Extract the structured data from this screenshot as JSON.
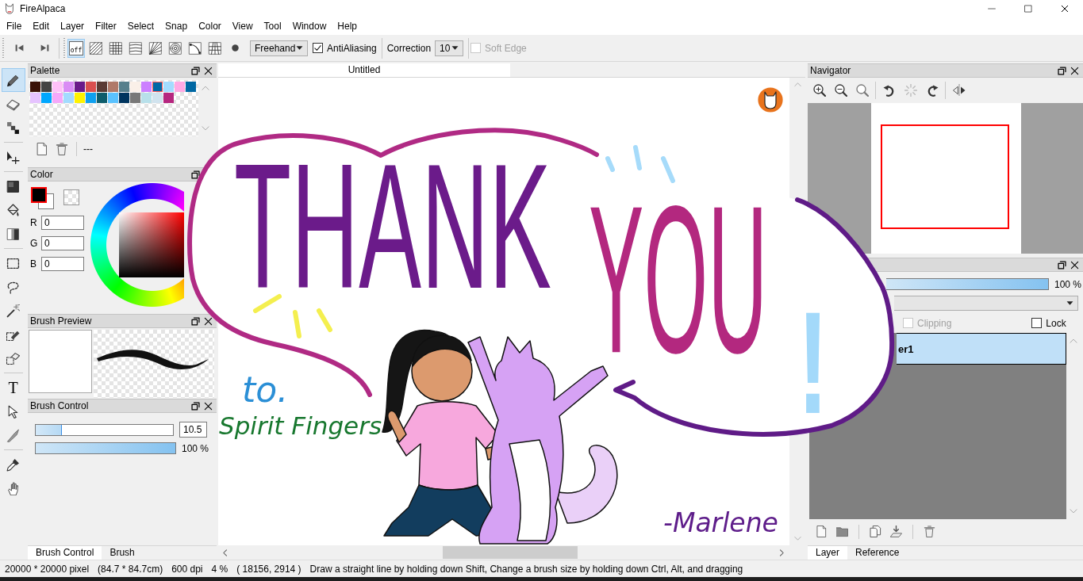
{
  "window": {
    "title": "FireAlpaca"
  },
  "menu": [
    "File",
    "Edit",
    "Layer",
    "Filter",
    "Select",
    "Snap",
    "Color",
    "View",
    "Tool",
    "Window",
    "Help"
  ],
  "toolbar": {
    "snap_modes": [
      {
        "label": "off",
        "selected": true
      },
      {
        "selected": false
      },
      {
        "selected": false
      },
      {
        "selected": false
      },
      {
        "selected": false
      },
      {
        "selected": false
      },
      {
        "selected": false
      },
      {
        "selected": false
      },
      {
        "selected": false
      }
    ],
    "stroke_mode": "Freehand",
    "antialiasing": {
      "label": "AntiAliasing",
      "checked": true
    },
    "correction": {
      "label": "Correction",
      "value": "10"
    },
    "soft_edge": {
      "label": "Soft Edge",
      "checked": false,
      "disabled": true
    }
  },
  "tool_groups": [
    [
      {
        "selected": true
      },
      {
        "selected": false
      },
      {
        "selected": false
      }
    ],
    [
      {
        "selected": false
      }
    ],
    [
      {
        "selected": false
      },
      {
        "selected": false
      },
      {
        "selected": false
      }
    ],
    [
      {
        "selected": false
      },
      {
        "selected": false
      },
      {
        "selected": false
      },
      {
        "selected": false
      },
      {
        "selected": false
      }
    ],
    [
      {
        "glyph": "T",
        "selected": false
      },
      {
        "selected": false
      },
      {
        "selected": false
      }
    ],
    [
      {
        "selected": false
      },
      {
        "selected": false
      }
    ]
  ],
  "palette": {
    "title": "Palette",
    "swatches": [
      {
        "color": "#3b1308",
        "selected": false
      },
      {
        "color": "#444444",
        "selected": false
      },
      {
        "color": "#ffc0f8",
        "selected": false
      },
      {
        "color": "#da8cf5",
        "selected": false
      },
      {
        "color": "#6b1a8a",
        "selected": false
      },
      {
        "color": "#da4f4f",
        "selected": false
      },
      {
        "color": "#5a3a34",
        "selected": false
      },
      {
        "color": "#b07a6a",
        "selected": false
      },
      {
        "color": "#567f8c",
        "selected": false
      },
      {
        "color": "#faf0e8",
        "selected": false
      },
      {
        "color": "#cc80ff",
        "selected": false
      },
      {
        "color": "#0068a6",
        "selected": true
      },
      {
        "color": "#a3dcff",
        "selected": false
      },
      {
        "color": "#ffaae4",
        "selected": false
      },
      {
        "color": "#0068a3",
        "selected": false
      },
      {
        "color": "#e6c3ff",
        "selected": false
      },
      {
        "color": "#00a7ff",
        "selected": false
      },
      {
        "color": "#f5a8fa",
        "selected": false
      },
      {
        "color": "#a3dbff",
        "selected": false
      },
      {
        "color": "#fff200",
        "selected": false
      },
      {
        "color": "#0fa0f0",
        "selected": false
      },
      {
        "color": "#0e5d6c",
        "selected": false
      },
      {
        "color": "#5ac2ff",
        "selected": false
      },
      {
        "color": "#00355f",
        "selected": false
      },
      {
        "color": "#787878",
        "selected": false
      },
      {
        "color": "#b8e0ea",
        "selected": false
      },
      {
        "color": "#d1e3ee",
        "selected": false
      },
      {
        "color": "#b6267f",
        "selected": false
      }
    ],
    "set_name": "---"
  },
  "color": {
    "title": "Color",
    "channels": [
      {
        "label": "R",
        "value": "0"
      },
      {
        "label": "G",
        "value": "0"
      },
      {
        "label": "B",
        "value": "0"
      }
    ]
  },
  "brush_preview": {
    "title": "Brush Preview"
  },
  "brush_control": {
    "title": "Brush Control",
    "size": {
      "level": 0.19,
      "value": "10.5"
    },
    "opacity": {
      "level": 1.0,
      "reading": "100 %"
    }
  },
  "left_tabs": [
    {
      "label": "Brush Control",
      "selected": true
    },
    {
      "label": "Brush",
      "selected": false
    }
  ],
  "canvas": {
    "tab": "Untitled"
  },
  "navigator": {
    "title": "Navigator"
  },
  "layer_panel": {
    "opacity": {
      "level": 1.0,
      "reading": "100 %"
    },
    "clipping": {
      "label": "Clipping",
      "checked": false,
      "disabled": true
    },
    "lock": {
      "label": "Lock",
      "checked": false
    },
    "layers": [
      {
        "name": "er1",
        "selected": true
      }
    ]
  },
  "right_tabs": [
    {
      "label": "Layer",
      "selected": true
    },
    {
      "label": "Reference",
      "selected": false
    }
  ],
  "status_bar": [
    "20000 * 20000 pixel",
    "(84.7 * 84.7cm)",
    "600 dpi",
    "4 %",
    "( 18156, 2914 )",
    "Draw a straight line by holding down Shift, Change a brush size by holding down Ctrl, Alt, and dragging"
  ],
  "artwork": {
    "words": [
      {
        "text": "THANK",
        "color": "#6b1b8a"
      },
      {
        "text": "YOU",
        "color": "#b3287f"
      },
      {
        "text": "!",
        "color": "#a3d9fa"
      }
    ],
    "dedication": [
      {
        "text": "to.",
        "color": "#2b8fd6"
      },
      {
        "text": "Spirit Fingers",
        "color": "#17772e"
      }
    ],
    "signature": "-Marlene"
  }
}
